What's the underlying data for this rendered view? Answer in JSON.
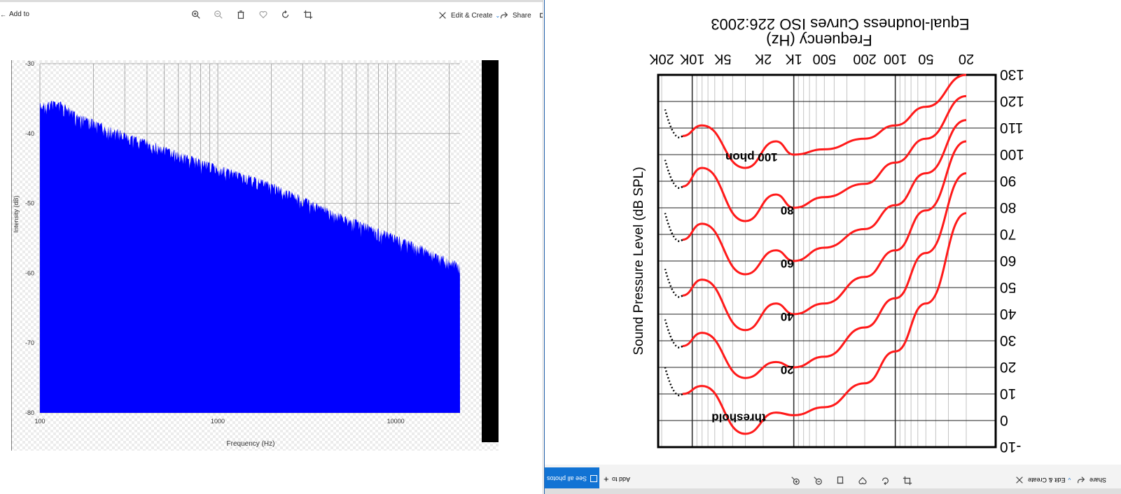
{
  "left_toolbar": {
    "add_to": "Add to",
    "edit_create": "Edit & Create",
    "share": "Share",
    "icons": [
      "zoom-in-icon",
      "zoom-out-icon",
      "delete-icon",
      "favorite-icon",
      "rotate-icon",
      "crop-icon"
    ]
  },
  "right_toolbar": {
    "see_all_photos": "See all photos",
    "add_to": "Add to",
    "edit_create": "Edit & Create",
    "share": "Share",
    "icons": [
      "zoom-in-icon",
      "zoom-out-icon",
      "delete-icon",
      "favorite-icon",
      "rotate-icon",
      "crop-icon"
    ]
  },
  "spectrum": {
    "xlabel": "Frequency (Hz)",
    "ylabel": "Intensity (dB)",
    "x_ticks": [
      "100",
      "1000",
      "10000"
    ],
    "y_ticks": [
      "-30",
      "-40",
      "-50",
      "-60",
      "-70",
      "-80"
    ],
    "fill_color": "#0000ff",
    "chart_data": {
      "type": "area",
      "x_scale": "log",
      "xlim": [
        100,
        23000
      ],
      "ylim": [
        -80,
        -30
      ],
      "grid": true,
      "x": [
        100,
        125,
        150,
        200,
        300,
        500,
        1000,
        2000,
        5000,
        10000,
        15000,
        22000
      ],
      "y": [
        -35.6,
        -35.0,
        -36.5,
        -38.0,
        -39.8,
        -41.8,
        -44.5,
        -47.0,
        -51.5,
        -54.5,
        -56.3,
        -58.3
      ]
    }
  },
  "equal_loudness": {
    "title": "Equal-loudness Curves ISO 226:2003",
    "xlabel": "Frequency (Hz)",
    "ylabel": "Sound Pressure Level (dB SPL)",
    "x_ticks": [
      "20",
      "50",
      "100",
      "200",
      "500",
      "1K",
      "2K",
      "5K",
      "10K",
      "20K"
    ],
    "y_ticks": [
      "-10",
      "0",
      "10",
      "20",
      "30",
      "40",
      "50",
      "60",
      "70",
      "80",
      "90",
      "100",
      "110",
      "120",
      "130"
    ],
    "curve_labels": [
      "threshold",
      "20",
      "40",
      "60",
      "80",
      "100 phon"
    ],
    "curve_color": "#ff1a1a",
    "chart_data": {
      "type": "line",
      "x_scale": "log",
      "xlim": [
        20,
        20000
      ],
      "ylim": [
        -10,
        130
      ],
      "x": [
        20,
        50,
        100,
        200,
        500,
        1000,
        1500,
        3000,
        8000,
        12500
      ],
      "series": [
        {
          "name": "threshold",
          "values": [
            78,
            44,
            26,
            14,
            5,
            2,
            3,
            -5,
            13,
            10
          ]
        },
        {
          "name": "20",
          "values": [
            93,
            63,
            46,
            35,
            24,
            20,
            22,
            16,
            33,
            28
          ]
        },
        {
          "name": "40",
          "values": [
            105,
            79,
            64,
            54,
            44,
            40,
            44,
            34,
            53,
            47
          ]
        },
        {
          "name": "60",
          "values": [
            113,
            93,
            81,
            72,
            65,
            60,
            64,
            55,
            74,
            68
          ]
        },
        {
          "name": "80",
          "values": [
            122,
            106,
            97,
            89,
            84,
            80,
            85,
            75,
            95,
            88
          ]
        },
        {
          "name": "100 phon",
          "values": [
            130,
            118,
            111,
            106,
            102,
            100,
            105,
            95,
            111,
            107
          ]
        }
      ]
    }
  }
}
